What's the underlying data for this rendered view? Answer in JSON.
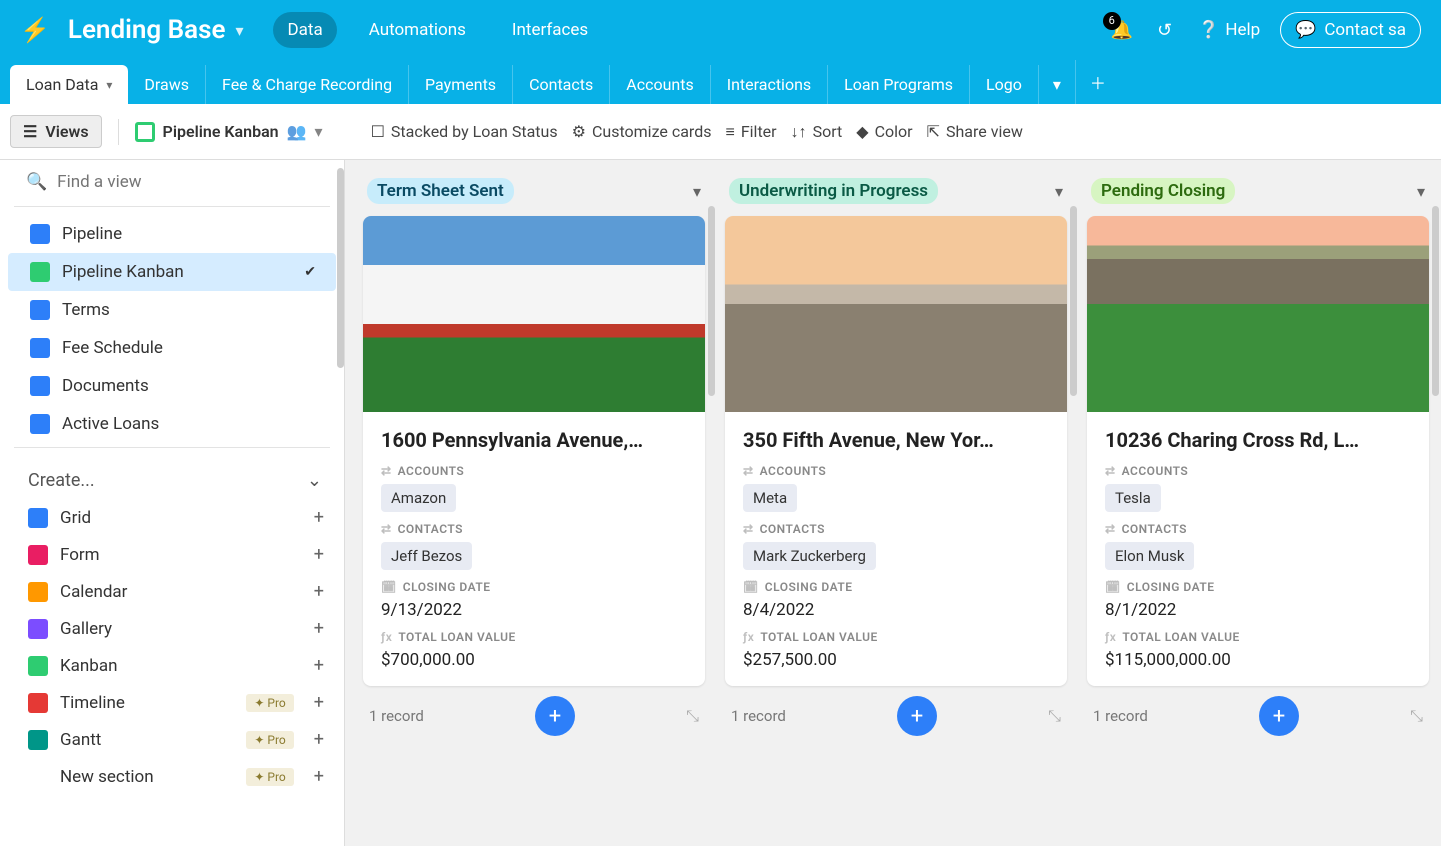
{
  "app": {
    "name": "Lending Base"
  },
  "topnav": {
    "items": [
      "Data",
      "Automations",
      "Interfaces"
    ],
    "active": 0,
    "notifications": "6",
    "help": "Help",
    "contact": "Contact sa"
  },
  "tabs": {
    "items": [
      "Loan Data",
      "Draws",
      "Fee & Charge Recording",
      "Payments",
      "Contacts",
      "Accounts",
      "Interactions",
      "Loan Programs",
      "Logo"
    ],
    "active": 0
  },
  "toolbar": {
    "views": "Views",
    "viewname": "Pipeline Kanban",
    "stacked": "Stacked by Loan Status",
    "customize": "Customize cards",
    "filter": "Filter",
    "sort": "Sort",
    "color": "Color",
    "share": "Share view"
  },
  "sidebar": {
    "search_placeholder": "Find a view",
    "views": [
      {
        "icon": "grid",
        "label": "Pipeline"
      },
      {
        "icon": "kan",
        "label": "Pipeline Kanban",
        "active": true
      },
      {
        "icon": "grid",
        "label": "Terms"
      },
      {
        "icon": "grid",
        "label": "Fee Schedule"
      },
      {
        "icon": "grid",
        "label": "Documents"
      },
      {
        "icon": "grid",
        "label": "Active Loans"
      }
    ],
    "create_header": "Create...",
    "create": [
      {
        "icon": "grid",
        "label": "Grid"
      },
      {
        "icon": "form",
        "label": "Form"
      },
      {
        "icon": "cal",
        "label": "Calendar"
      },
      {
        "icon": "gal",
        "label": "Gallery"
      },
      {
        "icon": "kan",
        "label": "Kanban"
      },
      {
        "icon": "tl",
        "label": "Timeline",
        "pro": true
      },
      {
        "icon": "gn",
        "label": "Gantt",
        "pro": true
      },
      {
        "icon": "",
        "label": "New section",
        "pro": true
      }
    ],
    "pro_label": "Pro"
  },
  "field_labels": {
    "accounts": "ACCOUNTS",
    "contacts": "CONTACTS",
    "closing": "CLOSING DATE",
    "loanval": "TOTAL LOAN VALUE"
  },
  "columns": [
    {
      "status": "Term Sheet Sent",
      "pill": "blue",
      "records_label": "1 record",
      "cards": [
        {
          "img": "wh",
          "title": "1600 Pennsylvania Avenue,…",
          "accounts": "Amazon",
          "contacts": "Jeff Bezos",
          "closing": "9/13/2022",
          "loan": "$700,000.00"
        }
      ]
    },
    {
      "status": "Underwriting in Progress",
      "pill": "teal",
      "records_label": "1 record",
      "cards": [
        {
          "img": "ny",
          "title": "350 Fifth Avenue, New Yor…",
          "accounts": "Meta",
          "contacts": "Mark Zuckerberg",
          "closing": "8/4/2022",
          "loan": "$257,500.00"
        }
      ]
    },
    {
      "status": "Pending Closing",
      "pill": "green",
      "records_label": "1 record",
      "cards": [
        {
          "img": "la",
          "title": "10236 Charing Cross Rd, L…",
          "accounts": "Tesla",
          "contacts": "Elon Musk",
          "closing": "8/1/2022",
          "loan": "$115,000,000.00"
        }
      ]
    }
  ]
}
